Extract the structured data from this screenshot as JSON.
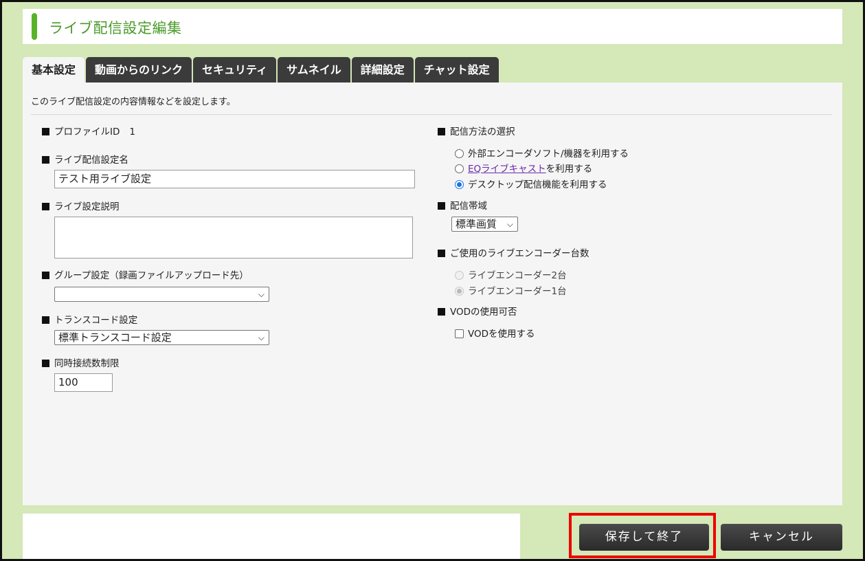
{
  "header": {
    "title": "ライブ配信設定編集"
  },
  "tabs": [
    {
      "label": "基本設定",
      "active": true
    },
    {
      "label": "動画からのリンク"
    },
    {
      "label": "セキュリティ"
    },
    {
      "label": "サムネイル"
    },
    {
      "label": "詳細設定"
    },
    {
      "label": "チャット設定"
    }
  ],
  "panel": {
    "description": "このライブ配信設定の内容情報などを設定します。",
    "profile_id": {
      "label": "プロファイルID",
      "value": "1"
    },
    "name": {
      "label": "ライブ配信設定名",
      "value": "テスト用ライブ設定"
    },
    "explanation": {
      "label": "ライブ設定説明",
      "value": ""
    },
    "group": {
      "label": "グループ設定（録画ファイルアップロード先）",
      "value": ""
    },
    "transcode": {
      "label": "トランスコード設定",
      "value": "標準トランスコード設定"
    },
    "connections": {
      "label": "同時接続数制限",
      "value": "100"
    },
    "method": {
      "label": "配信方法の選択",
      "options": [
        {
          "text": "外部エンコーダソフト/機器を利用する",
          "checked": false
        },
        {
          "link": "EQライブキャスト",
          "text": "を利用する",
          "checked": false
        },
        {
          "text": "デスクトップ配信機能を利用する",
          "checked": true
        }
      ]
    },
    "bandwidth": {
      "label": "配信帯域",
      "value": "標準画質"
    },
    "encoders": {
      "label": "ご使用のライブエンコーダー台数",
      "options": [
        {
          "text": "ライブエンコーダー2台",
          "checked": false
        },
        {
          "text": "ライブエンコーダー1台",
          "checked": true
        }
      ]
    },
    "vod": {
      "label": "VODの使用可否",
      "checkbox_label": "VODを使用する",
      "checked": false
    }
  },
  "buttons": {
    "save": "保存して終了",
    "cancel": "キャンセル"
  },
  "colors": {
    "accent": "#59b32a",
    "background": "#d4e8b8",
    "highlight": "#e00000",
    "radio": "#1a73e8"
  }
}
